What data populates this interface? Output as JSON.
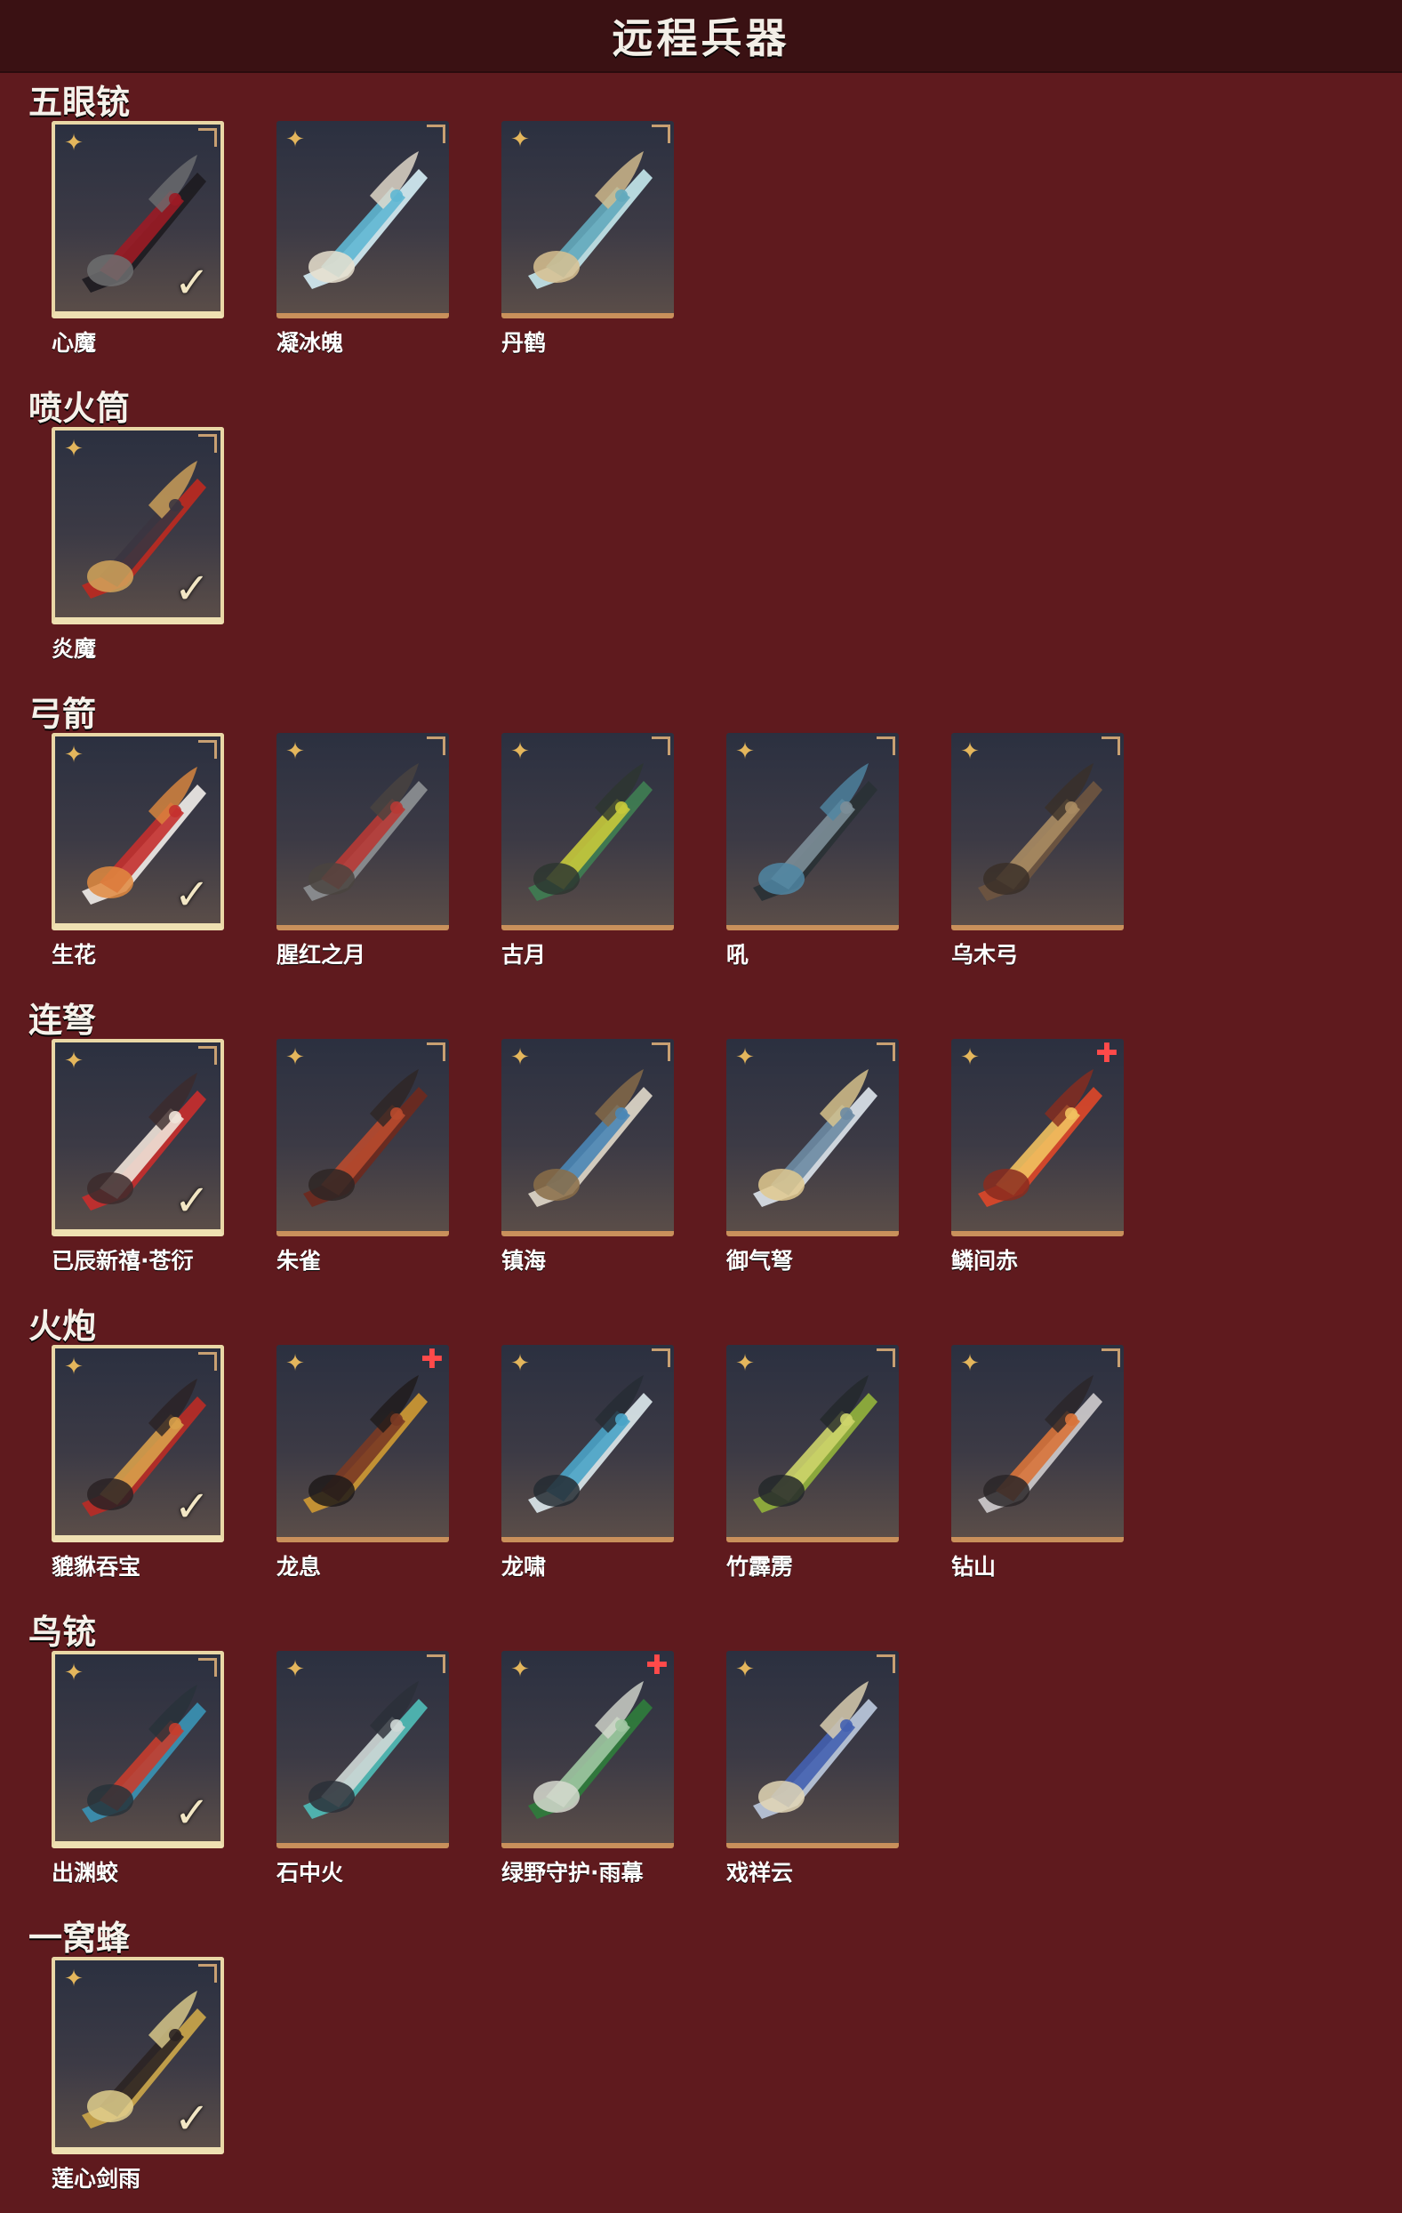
{
  "header": {
    "title": "远程兵器"
  },
  "sections": [
    {
      "title": "五眼铳",
      "items": [
        {
          "name": "心魔",
          "owned": true,
          "new": false,
          "palette": [
            "#1f1c22",
            "#9b1b25",
            "#6d6e70"
          ]
        },
        {
          "name": "凝冰魄",
          "owned": false,
          "new": false,
          "palette": [
            "#cfe7ee",
            "#5fb7d3",
            "#e8e0cf"
          ]
        },
        {
          "name": "丹鹤",
          "owned": false,
          "new": false,
          "palette": [
            "#bfe0e6",
            "#63aabd",
            "#d8c190"
          ]
        }
      ]
    },
    {
      "title": "喷火筒",
      "items": [
        {
          "name": "炎魔",
          "owned": true,
          "new": false,
          "palette": [
            "#b72a22",
            "#3b3540",
            "#d2a45a"
          ]
        }
      ]
    },
    {
      "title": "弓箭",
      "items": [
        {
          "name": "生花",
          "owned": true,
          "new": false,
          "palette": [
            "#e9e6e3",
            "#c4302d",
            "#e0893f"
          ]
        },
        {
          "name": "腥红之月",
          "owned": false,
          "new": false,
          "palette": [
            "#8a8d90",
            "#b73a35",
            "#4a4440"
          ]
        },
        {
          "name": "古月",
          "owned": false,
          "new": false,
          "palette": [
            "#3f7b52",
            "#c7c93b",
            "#2d3630"
          ]
        },
        {
          "name": "吼",
          "owned": false,
          "new": false,
          "palette": [
            "#2a3136",
            "#7c8e98",
            "#4f86a3"
          ]
        },
        {
          "name": "乌木弓",
          "owned": false,
          "new": false,
          "palette": [
            "#6d5440",
            "#a88b62",
            "#3a2f28"
          ]
        }
      ]
    },
    {
      "title": "连弩",
      "items": [
        {
          "name": "已辰新禧·苍衍",
          "owned": true,
          "new": false,
          "palette": [
            "#c22e2e",
            "#efe3d8",
            "#3c2a2c"
          ]
        },
        {
          "name": "朱雀",
          "owned": false,
          "new": false,
          "palette": [
            "#6b2a20",
            "#b84a2e",
            "#2e2624"
          ]
        },
        {
          "name": "镇海",
          "owned": false,
          "new": false,
          "palette": [
            "#d9d2c4",
            "#4a86b5",
            "#8a6d48"
          ]
        },
        {
          "name": "御气弩",
          "owned": false,
          "new": false,
          "palette": [
            "#d6dde5",
            "#6d8ba3",
            "#e0c98f"
          ]
        },
        {
          "name": "鳞间赤",
          "owned": false,
          "new": true,
          "palette": [
            "#d7472a",
            "#f1c15f",
            "#8a2c1e"
          ]
        }
      ]
    },
    {
      "title": "火炮",
      "items": [
        {
          "name": "貔貅吞宝",
          "owned": true,
          "new": false,
          "palette": [
            "#b52c27",
            "#d8a04a",
            "#2a2224"
          ]
        },
        {
          "name": "龙息",
          "owned": false,
          "new": true,
          "palette": [
            "#c99634",
            "#7a3a24",
            "#1f1a1a"
          ]
        },
        {
          "name": "龙啸",
          "owned": false,
          "new": false,
          "palette": [
            "#d6e1e6",
            "#4aa3c6",
            "#252c33"
          ]
        },
        {
          "name": "竹霹雳",
          "owned": false,
          "new": false,
          "palette": [
            "#8fae3c",
            "#cdd46a",
            "#23282a"
          ]
        },
        {
          "name": "钻山",
          "owned": false,
          "new": false,
          "palette": [
            "#c9c6c8",
            "#d8733a",
            "#2a2628"
          ]
        }
      ]
    },
    {
      "title": "鸟铳",
      "items": [
        {
          "name": "出渊蛟",
          "owned": true,
          "new": false,
          "palette": [
            "#3a8fb0",
            "#c53d2d",
            "#28323a"
          ]
        },
        {
          "name": "石中火",
          "owned": false,
          "new": false,
          "palette": [
            "#4fb7b3",
            "#cfd8d6",
            "#2a3038"
          ]
        },
        {
          "name": "绿野守护·雨幕",
          "owned": false,
          "new": true,
          "palette": [
            "#2f7a3c",
            "#a0c7a2",
            "#d6d9cf"
          ]
        },
        {
          "name": "戏祥云",
          "owned": false,
          "new": false,
          "palette": [
            "#b7c4d8",
            "#4461b0",
            "#e2d6b5"
          ]
        }
      ]
    },
    {
      "title": "一窝蜂",
      "items": [
        {
          "name": "莲心剑雨",
          "owned": true,
          "new": false,
          "palette": [
            "#c6a24a",
            "#2b2422",
            "#e1cf8d"
          ]
        }
      ]
    }
  ],
  "icons": {
    "rarity": "four-point-star-icon",
    "owned": "checkmark-icon",
    "new": "new-badge-icon",
    "corner": "corner-bracket-icon"
  }
}
